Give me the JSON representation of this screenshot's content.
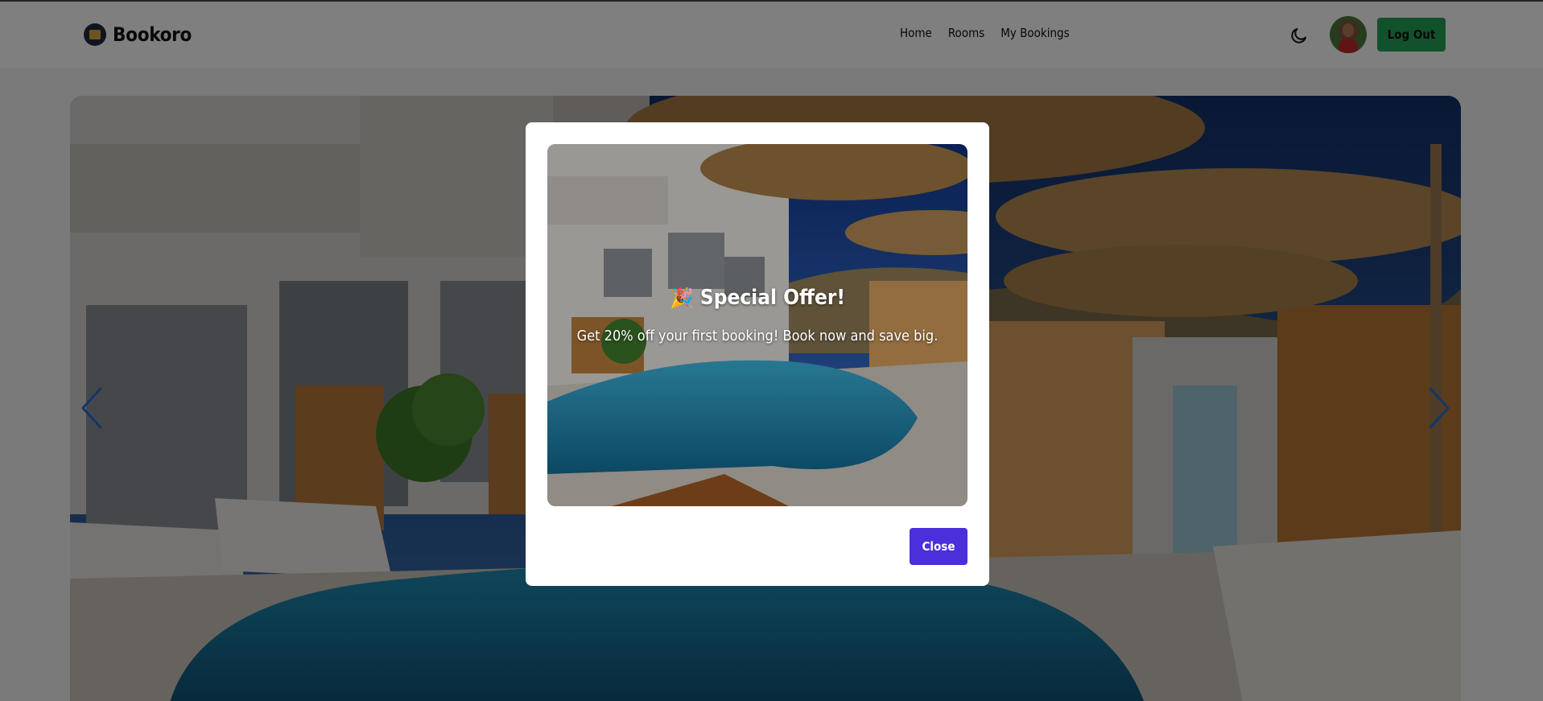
{
  "header": {
    "brand_name": "Bookoro",
    "nav": [
      {
        "label": "Home"
      },
      {
        "label": "Rooms"
      },
      {
        "label": "My Bookings"
      }
    ],
    "theme_toggle_icon": "moon-icon",
    "logout_label": "Log Out"
  },
  "hero": {
    "prev_icon": "chevron-left-icon",
    "next_icon": "chevron-right-icon"
  },
  "modal": {
    "emoji": "🎉",
    "title": "Special Offer!",
    "description": "Get 20% off your first booking! Book now and save big.",
    "close_label": "Close"
  },
  "colors": {
    "logout_bg": "#22a55a",
    "close_bg": "#4a2fdb",
    "arrow": "#1d6ed6"
  }
}
